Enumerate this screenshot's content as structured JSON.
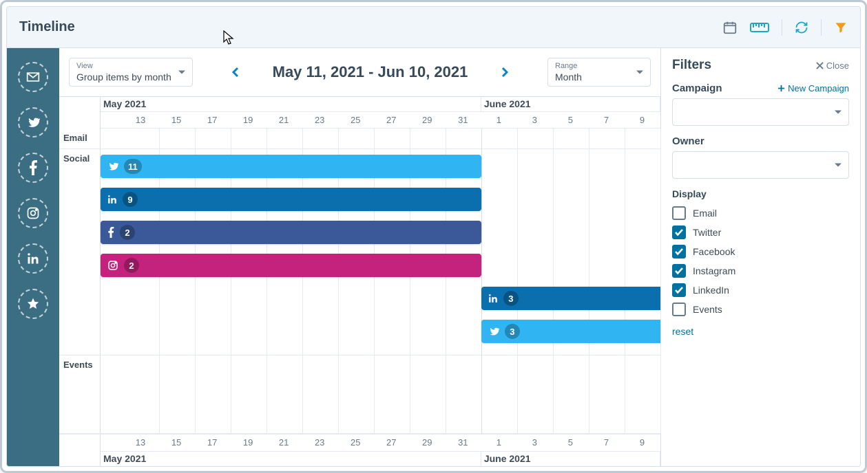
{
  "header": {
    "title": "Timeline"
  },
  "controls": {
    "view_label": "View",
    "view_value": "Group items by month",
    "date_range": "May 11, 2021 - Jun 10, 2021",
    "range_label": "Range",
    "range_value": "Month"
  },
  "months": [
    "May 2021",
    "June 2021"
  ],
  "ticks_may": [
    "13",
    "15",
    "17",
    "19",
    "21",
    "23",
    "25",
    "27",
    "29",
    "31"
  ],
  "ticks_june": [
    "1",
    "3",
    "5",
    "7",
    "9"
  ],
  "rows": {
    "email": "Email",
    "social": "Social",
    "events": "Events"
  },
  "bars": {
    "may_twitter": "11",
    "may_linkedin": "9",
    "may_facebook": "2",
    "may_instagram": "2",
    "jun_linkedin": "3",
    "jun_twitter": "3"
  },
  "filters": {
    "title": "Filters",
    "close": "Close",
    "campaign_label": "Campaign",
    "new_campaign": "New Campaign",
    "owner_label": "Owner",
    "display_label": "Display",
    "items": {
      "email": "Email",
      "twitter": "Twitter",
      "facebook": "Facebook",
      "instagram": "Instagram",
      "linkedin": "LinkedIn",
      "events": "Events"
    },
    "checked": {
      "email": false,
      "twitter": true,
      "facebook": true,
      "instagram": true,
      "linkedin": true,
      "events": false
    },
    "reset": "reset"
  }
}
